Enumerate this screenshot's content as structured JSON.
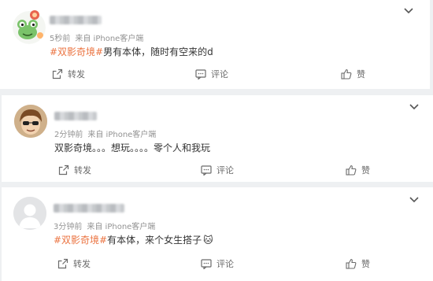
{
  "comments": [
    {
      "username": "",
      "time": "5秒前",
      "source": "来自 iPhone客户端",
      "tag": "#双影奇境#",
      "text": "男有本体，随时有空来的d",
      "emoji": "",
      "actions": {
        "repost": "转发",
        "comment": "评论",
        "like": "赞"
      }
    },
    {
      "username": "",
      "time": "2分钟前",
      "source": "来自 iPhone客户端",
      "tag": "",
      "text": "双影奇境。。。想玩。。。。零个人和我玩",
      "emoji": "",
      "actions": {
        "repost": "转发",
        "comment": "评论",
        "like": "赞"
      }
    },
    {
      "username": "",
      "time": "3分钟前",
      "source": "来自 iPhone客户端",
      "tag": "#双影奇境#",
      "text": "有本体，来个女生搭子",
      "emoji": "🐱",
      "actions": {
        "repost": "转发",
        "comment": "评论",
        "like": "赞"
      }
    }
  ],
  "colors": {
    "tag": "#eb7340",
    "meta": "#939393",
    "text": "#333333",
    "background": "#eef0f2"
  },
  "icons": [
    "frog-avatar",
    "boy-avatar",
    "default-avatar",
    "chevron-down-icon",
    "repost-icon",
    "comment-icon",
    "like-icon",
    "cat-emoji"
  ]
}
